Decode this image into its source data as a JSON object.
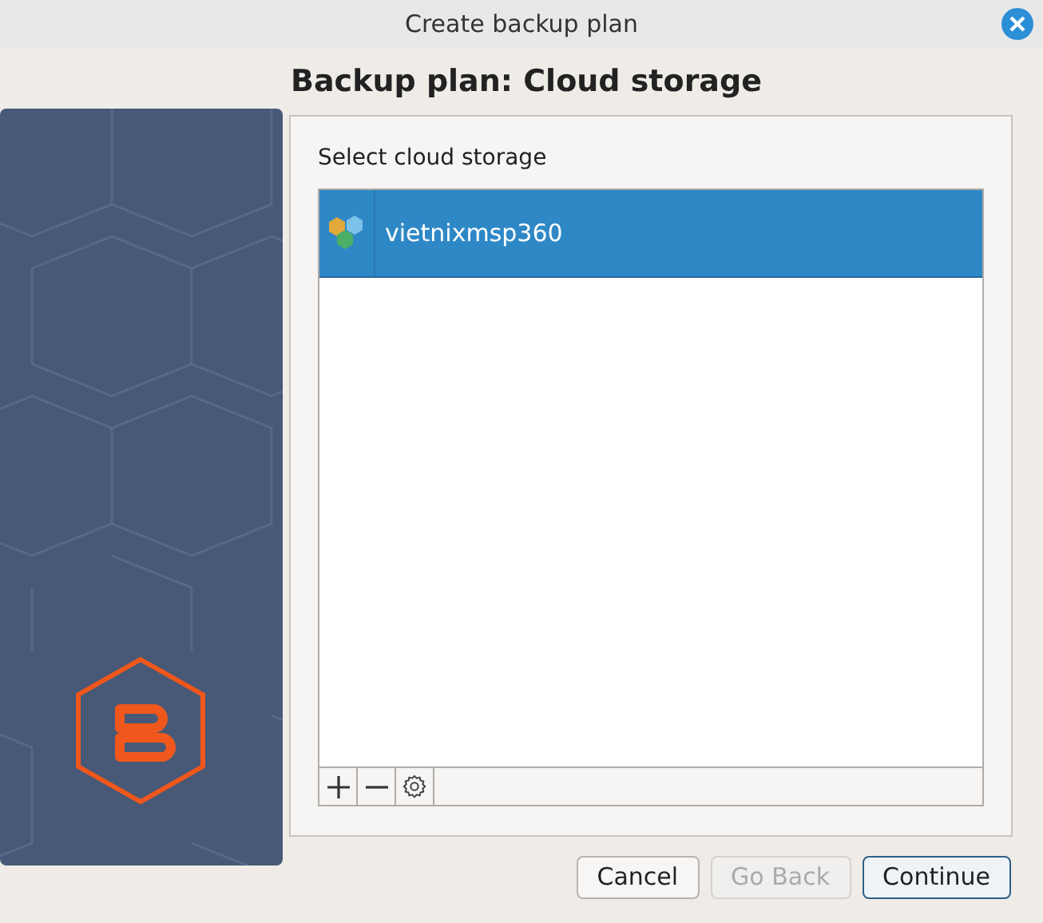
{
  "window": {
    "title": "Create backup plan"
  },
  "heading": "Backup plan: Cloud storage",
  "storage_list": {
    "label": "Select cloud storage",
    "items": [
      {
        "name": "vietnixmsp360",
        "selected": true
      }
    ],
    "toolbar": [
      {
        "kind": "add"
      },
      {
        "kind": "remove"
      },
      {
        "kind": "settings"
      }
    ]
  },
  "buttons": [
    {
      "label": "Cancel",
      "disabled": false,
      "default": false
    },
    {
      "label": "Go Back",
      "disabled": true,
      "default": false
    },
    {
      "label": "Continue",
      "disabled": false,
      "default": true
    }
  ]
}
